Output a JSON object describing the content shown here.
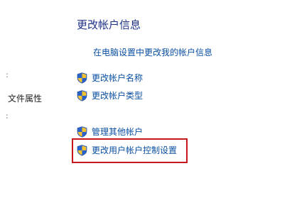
{
  "header": {
    "title": "更改帐户信息"
  },
  "links": {
    "pc_settings": "在电脑设置中更改我的帐户信息",
    "change_name": "更改帐户名称",
    "change_type": "更改帐户类型",
    "manage_other": "管理其他帐户",
    "uac_settings": "更改用户帐户控制设置"
  },
  "sidebar": {
    "file_properties": "文件属性",
    "marker_top": ":",
    "marker_bottom": ":"
  },
  "icons": {
    "task_icon": "uac-shield-icon"
  },
  "colors": {
    "heading": "#1e3287",
    "link": "#0a4fa3",
    "highlight_border": "#c8161d",
    "shield_blue": "#2a62c9",
    "shield_yellow": "#f2c230"
  }
}
